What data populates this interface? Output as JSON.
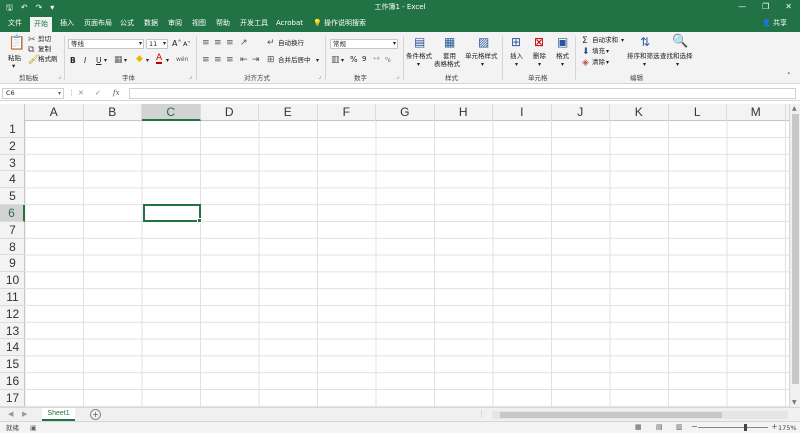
{
  "title_bar": {
    "window_title": "工作簿1 - Excel",
    "save_icon": "save-icon",
    "undo_icon": "undo-icon",
    "redo_icon": "redo-icon",
    "customize_icon": "customize-icon",
    "minimize": "—",
    "restore": "❐",
    "close": "✕"
  },
  "tabs": [
    {
      "label": "文件"
    },
    {
      "label": "开始"
    },
    {
      "label": "插入"
    },
    {
      "label": "页面布局"
    },
    {
      "label": "公式"
    },
    {
      "label": "数据"
    },
    {
      "label": "审阅"
    },
    {
      "label": "视图"
    },
    {
      "label": "帮助"
    },
    {
      "label": "开发工具"
    },
    {
      "label": "Acrobat"
    }
  ],
  "active_tab": "开始",
  "tell_me": "操作说明搜索",
  "share": "共享",
  "ribbon": {
    "clipboard": {
      "paste": "粘贴",
      "cut": "剪切",
      "copy": "复制",
      "format_painter": "格式刷",
      "label": "剪贴板"
    },
    "font": {
      "name": "等线",
      "size": "11",
      "grow": "A",
      "shrink": "A",
      "bold": "B",
      "italic": "I",
      "underline": "U",
      "wen": "wén",
      "label": "字体"
    },
    "alignment": {
      "wrap": "自动换行",
      "merge": "合并后居中",
      "label": "对齐方式"
    },
    "number": {
      "format": "常规",
      "percent": "%",
      "comma": "9",
      "label": "数字"
    },
    "styles": {
      "conditional": "条件格式",
      "table_line1": "套用",
      "table_line2": "表格格式",
      "cell_styles": "单元格样式",
      "label": "样式"
    },
    "cells": {
      "insert": "插入",
      "delete": "删除",
      "format": "格式",
      "label": "单元格"
    },
    "editing": {
      "autosum": "自动求和",
      "fill": "填充",
      "clear": "清除",
      "sort": "排序和筛选",
      "find": "查找和选择",
      "label": "编辑"
    }
  },
  "formula_bar": {
    "name_box": "C6",
    "cancel": "✕",
    "enter": "✓",
    "fx": "fx",
    "value": ""
  },
  "columns": [
    "A",
    "B",
    "C",
    "D",
    "E",
    "F",
    "G",
    "H",
    "I",
    "J",
    "K",
    "L",
    "M"
  ],
  "rows": [
    "1",
    "2",
    "3",
    "4",
    "5",
    "6",
    "7",
    "8",
    "9",
    "10",
    "11",
    "12",
    "13",
    "14",
    "15",
    "16",
    "17"
  ],
  "selected_col": "C",
  "selected_row": "6",
  "sheet_tabs": [
    {
      "label": "Sheet1",
      "active": true
    }
  ],
  "add_sheet": "+",
  "status": {
    "ready": "就绪",
    "zoom": "175%",
    "zoom_out": "−",
    "zoom_in": "+"
  },
  "colors": {
    "accent": "#217346",
    "ribbon": "#f3f3f3",
    "grid": "#e1e1e1"
  }
}
